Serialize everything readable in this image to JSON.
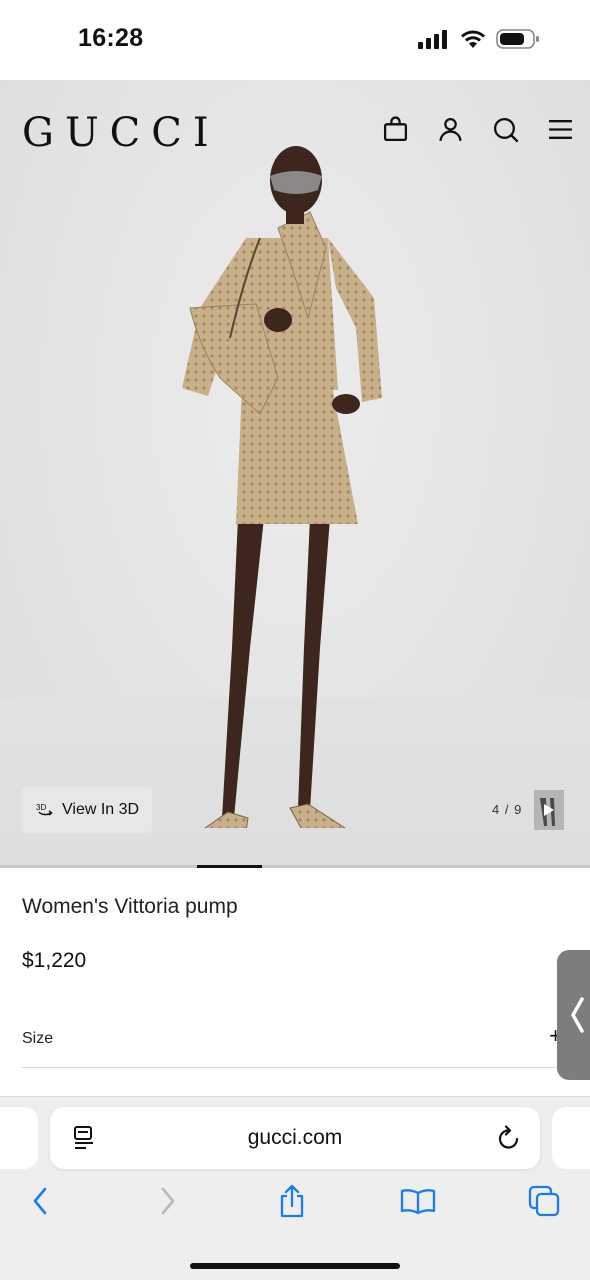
{
  "status_bar": {
    "time": "16:28"
  },
  "header": {
    "logo": "GUCCI",
    "icons": [
      "shopping-bag-icon",
      "account-icon",
      "search-icon",
      "menu-icon"
    ]
  },
  "gallery": {
    "view_3d_label": "View In 3D",
    "counter": "4 / 9",
    "current_index": 4,
    "total_images": 9
  },
  "product": {
    "name": "Women's Vittoria pump",
    "price": "$1,220",
    "size_label": "Size",
    "expand_symbol": "+"
  },
  "browser": {
    "url": "gucci.com",
    "toolbar_icons": [
      "back-icon",
      "forward-icon",
      "share-icon",
      "bookmarks-icon",
      "tabs-icon"
    ]
  },
  "colors": {
    "accent": "#1a7cf0",
    "text": "#111111",
    "hero_bg": "#e4e4e4",
    "beige": "#c9b082"
  }
}
